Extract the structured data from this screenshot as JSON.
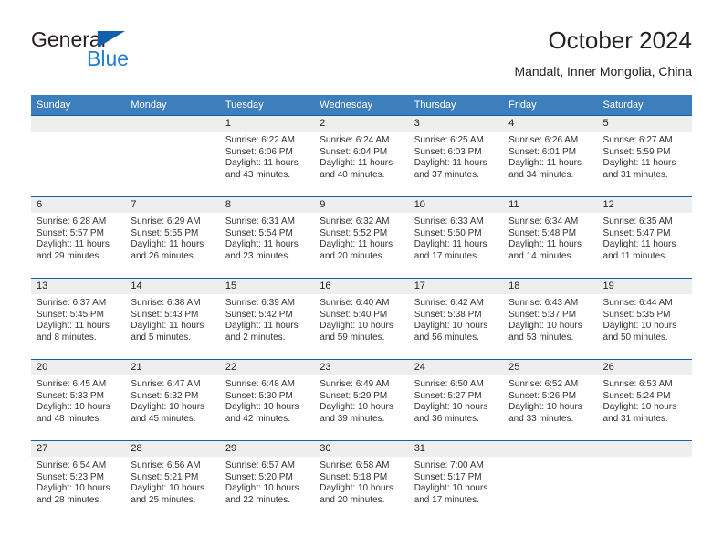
{
  "brand": {
    "name_top": "General",
    "name_bottom": "Blue",
    "accent_color": "#1d7fd1",
    "triangle_color": "#1261a8"
  },
  "header": {
    "title": "October 2024",
    "subtitle": "Mandalt, Inner Mongolia, China"
  },
  "calendar": {
    "header_bg": "#3d7ebd",
    "row_divider_color": "#1261a8",
    "daynum_bg": "#eeeeee",
    "weekday_headers": [
      "Sunday",
      "Monday",
      "Tuesday",
      "Wednesday",
      "Thursday",
      "Friday",
      "Saturday"
    ],
    "weeks": [
      [
        {
          "day": "",
          "sunrise": "",
          "sunset": "",
          "daylight": "",
          "empty": true
        },
        {
          "day": "",
          "sunrise": "",
          "sunset": "",
          "daylight": "",
          "empty": true
        },
        {
          "day": "1",
          "sunrise": "Sunrise: 6:22 AM",
          "sunset": "Sunset: 6:06 PM",
          "daylight": "Daylight: 11 hours and 43 minutes."
        },
        {
          "day": "2",
          "sunrise": "Sunrise: 6:24 AM",
          "sunset": "Sunset: 6:04 PM",
          "daylight": "Daylight: 11 hours and 40 minutes."
        },
        {
          "day": "3",
          "sunrise": "Sunrise: 6:25 AM",
          "sunset": "Sunset: 6:03 PM",
          "daylight": "Daylight: 11 hours and 37 minutes."
        },
        {
          "day": "4",
          "sunrise": "Sunrise: 6:26 AM",
          "sunset": "Sunset: 6:01 PM",
          "daylight": "Daylight: 11 hours and 34 minutes."
        },
        {
          "day": "5",
          "sunrise": "Sunrise: 6:27 AM",
          "sunset": "Sunset: 5:59 PM",
          "daylight": "Daylight: 11 hours and 31 minutes."
        }
      ],
      [
        {
          "day": "6",
          "sunrise": "Sunrise: 6:28 AM",
          "sunset": "Sunset: 5:57 PM",
          "daylight": "Daylight: 11 hours and 29 minutes."
        },
        {
          "day": "7",
          "sunrise": "Sunrise: 6:29 AM",
          "sunset": "Sunset: 5:55 PM",
          "daylight": "Daylight: 11 hours and 26 minutes."
        },
        {
          "day": "8",
          "sunrise": "Sunrise: 6:31 AM",
          "sunset": "Sunset: 5:54 PM",
          "daylight": "Daylight: 11 hours and 23 minutes."
        },
        {
          "day": "9",
          "sunrise": "Sunrise: 6:32 AM",
          "sunset": "Sunset: 5:52 PM",
          "daylight": "Daylight: 11 hours and 20 minutes."
        },
        {
          "day": "10",
          "sunrise": "Sunrise: 6:33 AM",
          "sunset": "Sunset: 5:50 PM",
          "daylight": "Daylight: 11 hours and 17 minutes."
        },
        {
          "day": "11",
          "sunrise": "Sunrise: 6:34 AM",
          "sunset": "Sunset: 5:48 PM",
          "daylight": "Daylight: 11 hours and 14 minutes."
        },
        {
          "day": "12",
          "sunrise": "Sunrise: 6:35 AM",
          "sunset": "Sunset: 5:47 PM",
          "daylight": "Daylight: 11 hours and 11 minutes."
        }
      ],
      [
        {
          "day": "13",
          "sunrise": "Sunrise: 6:37 AM",
          "sunset": "Sunset: 5:45 PM",
          "daylight": "Daylight: 11 hours and 8 minutes."
        },
        {
          "day": "14",
          "sunrise": "Sunrise: 6:38 AM",
          "sunset": "Sunset: 5:43 PM",
          "daylight": "Daylight: 11 hours and 5 minutes."
        },
        {
          "day": "15",
          "sunrise": "Sunrise: 6:39 AM",
          "sunset": "Sunset: 5:42 PM",
          "daylight": "Daylight: 11 hours and 2 minutes."
        },
        {
          "day": "16",
          "sunrise": "Sunrise: 6:40 AM",
          "sunset": "Sunset: 5:40 PM",
          "daylight": "Daylight: 10 hours and 59 minutes."
        },
        {
          "day": "17",
          "sunrise": "Sunrise: 6:42 AM",
          "sunset": "Sunset: 5:38 PM",
          "daylight": "Daylight: 10 hours and 56 minutes."
        },
        {
          "day": "18",
          "sunrise": "Sunrise: 6:43 AM",
          "sunset": "Sunset: 5:37 PM",
          "daylight": "Daylight: 10 hours and 53 minutes."
        },
        {
          "day": "19",
          "sunrise": "Sunrise: 6:44 AM",
          "sunset": "Sunset: 5:35 PM",
          "daylight": "Daylight: 10 hours and 50 minutes."
        }
      ],
      [
        {
          "day": "20",
          "sunrise": "Sunrise: 6:45 AM",
          "sunset": "Sunset: 5:33 PM",
          "daylight": "Daylight: 10 hours and 48 minutes."
        },
        {
          "day": "21",
          "sunrise": "Sunrise: 6:47 AM",
          "sunset": "Sunset: 5:32 PM",
          "daylight": "Daylight: 10 hours and 45 minutes."
        },
        {
          "day": "22",
          "sunrise": "Sunrise: 6:48 AM",
          "sunset": "Sunset: 5:30 PM",
          "daylight": "Daylight: 10 hours and 42 minutes."
        },
        {
          "day": "23",
          "sunrise": "Sunrise: 6:49 AM",
          "sunset": "Sunset: 5:29 PM",
          "daylight": "Daylight: 10 hours and 39 minutes."
        },
        {
          "day": "24",
          "sunrise": "Sunrise: 6:50 AM",
          "sunset": "Sunset: 5:27 PM",
          "daylight": "Daylight: 10 hours and 36 minutes."
        },
        {
          "day": "25",
          "sunrise": "Sunrise: 6:52 AM",
          "sunset": "Sunset: 5:26 PM",
          "daylight": "Daylight: 10 hours and 33 minutes."
        },
        {
          "day": "26",
          "sunrise": "Sunrise: 6:53 AM",
          "sunset": "Sunset: 5:24 PM",
          "daylight": "Daylight: 10 hours and 31 minutes."
        }
      ],
      [
        {
          "day": "27",
          "sunrise": "Sunrise: 6:54 AM",
          "sunset": "Sunset: 5:23 PM",
          "daylight": "Daylight: 10 hours and 28 minutes."
        },
        {
          "day": "28",
          "sunrise": "Sunrise: 6:56 AM",
          "sunset": "Sunset: 5:21 PM",
          "daylight": "Daylight: 10 hours and 25 minutes."
        },
        {
          "day": "29",
          "sunrise": "Sunrise: 6:57 AM",
          "sunset": "Sunset: 5:20 PM",
          "daylight": "Daylight: 10 hours and 22 minutes."
        },
        {
          "day": "30",
          "sunrise": "Sunrise: 6:58 AM",
          "sunset": "Sunset: 5:18 PM",
          "daylight": "Daylight: 10 hours and 20 minutes."
        },
        {
          "day": "31",
          "sunrise": "Sunrise: 7:00 AM",
          "sunset": "Sunset: 5:17 PM",
          "daylight": "Daylight: 10 hours and 17 minutes."
        },
        {
          "day": "",
          "sunrise": "",
          "sunset": "",
          "daylight": "",
          "empty": true
        },
        {
          "day": "",
          "sunrise": "",
          "sunset": "",
          "daylight": "",
          "empty": true
        }
      ]
    ]
  }
}
